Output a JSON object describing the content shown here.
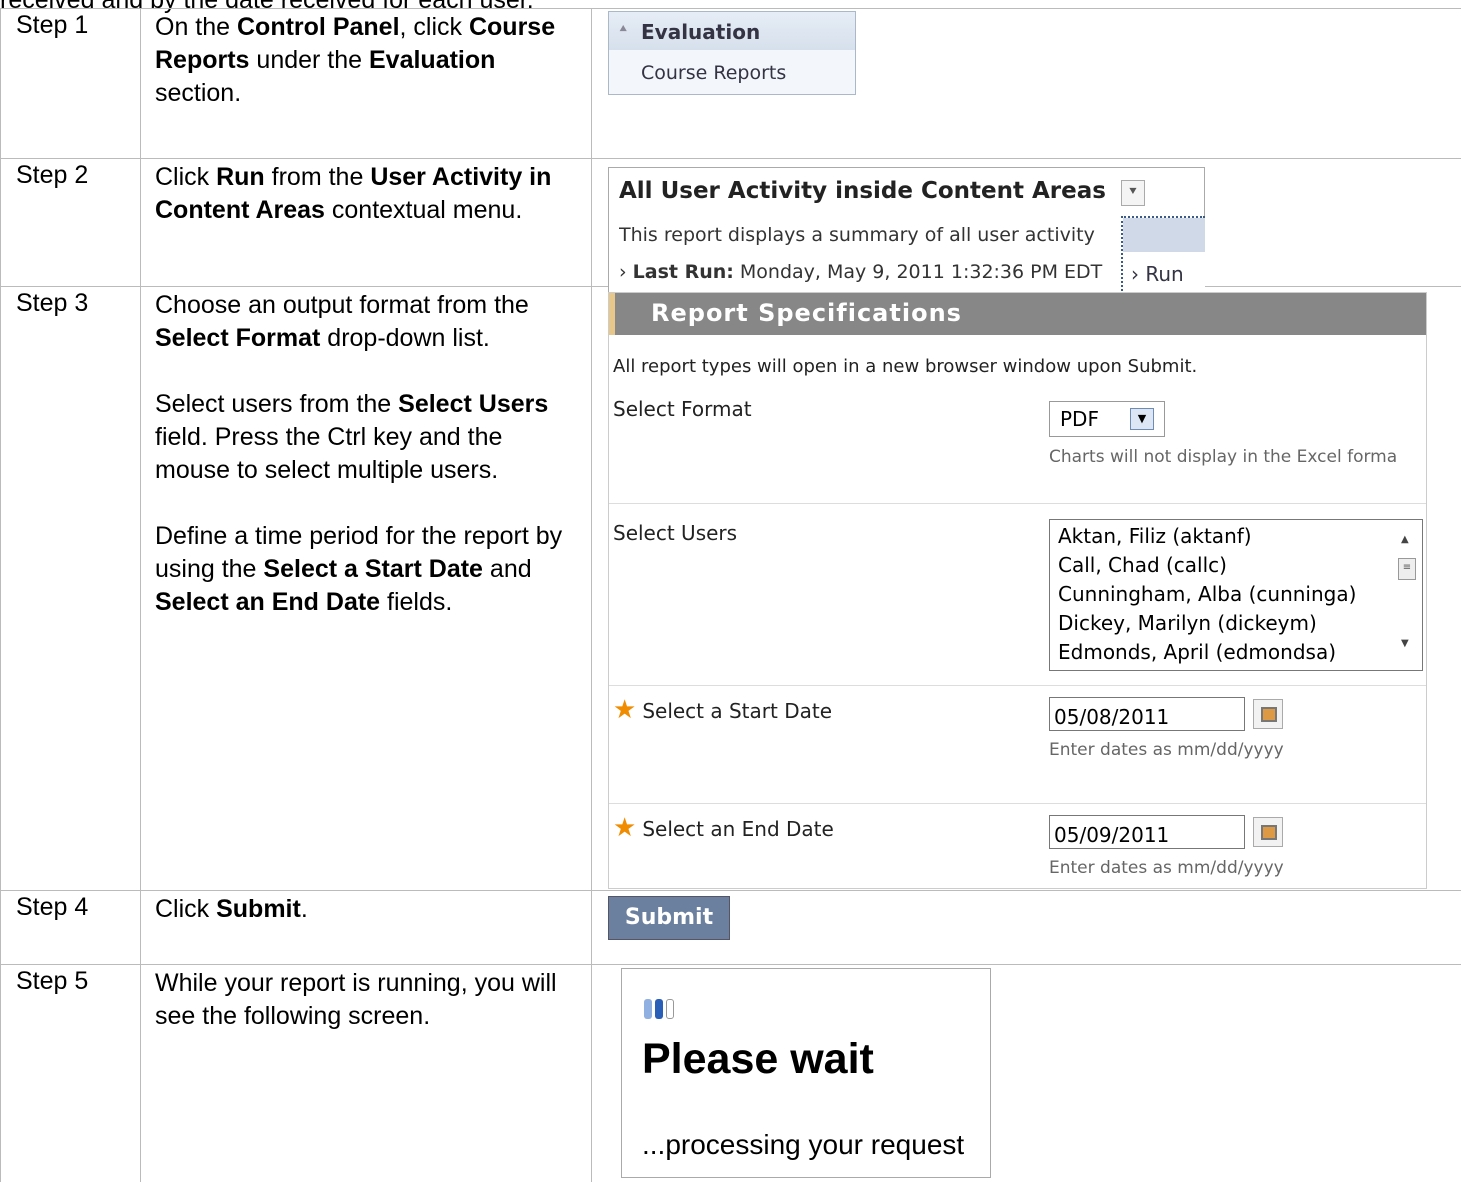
{
  "cut_text": "received and by the date received for each user.",
  "steps": [
    {
      "label": "Step 1"
    },
    {
      "label": "Step 2"
    },
    {
      "label": "Step 3"
    },
    {
      "label": "Step 4"
    },
    {
      "label": "Step 5"
    }
  ],
  "step1": {
    "t1": "On the ",
    "b1": "Control Panel",
    "t2": ", click ",
    "b2": "Course Reports",
    "t3": " under the ",
    "b3": "Evaluation",
    "t4": " section.",
    "widget": {
      "section": "Evaluation",
      "item": "Course Reports"
    }
  },
  "step2": {
    "t1": "Click ",
    "b1": "Run",
    "t2": " from the ",
    "b2": "User Activity in Content Areas",
    "t3": " contextual menu.",
    "widget": {
      "title": "All User Activity inside Content Areas",
      "description": "This report displays a summary of all user activity",
      "last_run_label": "Last Run:",
      "last_run_value": " Monday, May 9, 2011 1:32:36 PM EDT",
      "menu_item": "Run"
    }
  },
  "step3": {
    "p1": {
      "t1": "Choose an output format from the ",
      "b1": "Select Format",
      "t2": " drop-down list."
    },
    "p2": {
      "t1": "Select users from the ",
      "b1": "Select Users",
      "t2": " field. Press the Ctrl key and the mouse to select multiple users."
    },
    "p3": {
      "t1": "Define a time period for the report by using the ",
      "b1": "Select a Start Date",
      "t2": " and ",
      "b2": "Select an End Date",
      "t3": " fields."
    },
    "widget": {
      "header": "Report Specifications",
      "intro": "All report types will open in a new browser window upon Submit.",
      "format_label": "Select Format",
      "format_value": "PDF",
      "format_hint": "Charts will not display in the Excel forma",
      "users_label": "Select Users",
      "users": [
        "Aktan, Filiz (aktanf)",
        "Call, Chad (callc)",
        "Cunningham, Alba (cunninga)",
        "Dickey, Marilyn (dickeym)",
        "Edmonds, April (edmondsa)"
      ],
      "start_label": "Select a Start Date",
      "start_value": "05/08/2011",
      "end_label": "Select an End Date",
      "end_value": "05/09/2011",
      "date_hint": "Enter dates as mm/dd/yyyy",
      "required_mark": "★"
    }
  },
  "step4": {
    "t1": "Click ",
    "b1": "Submit",
    "t2": ".",
    "button": "Submit"
  },
  "step5": {
    "text": "While your report is running, you will see the following screen.",
    "widget": {
      "title": "Please wait",
      "subtitle": "...processing your request"
    }
  },
  "icons": {
    "collapse": "double-chevron-up-icon",
    "dropdown": "double-chevron-down-icon",
    "calendar": "calendar-icon",
    "spinner": "loading-spinner-icon"
  },
  "colors": {
    "spec_header": "#878787",
    "required_star": "#f08c00",
    "submit_bg": "#6b7f9e"
  }
}
